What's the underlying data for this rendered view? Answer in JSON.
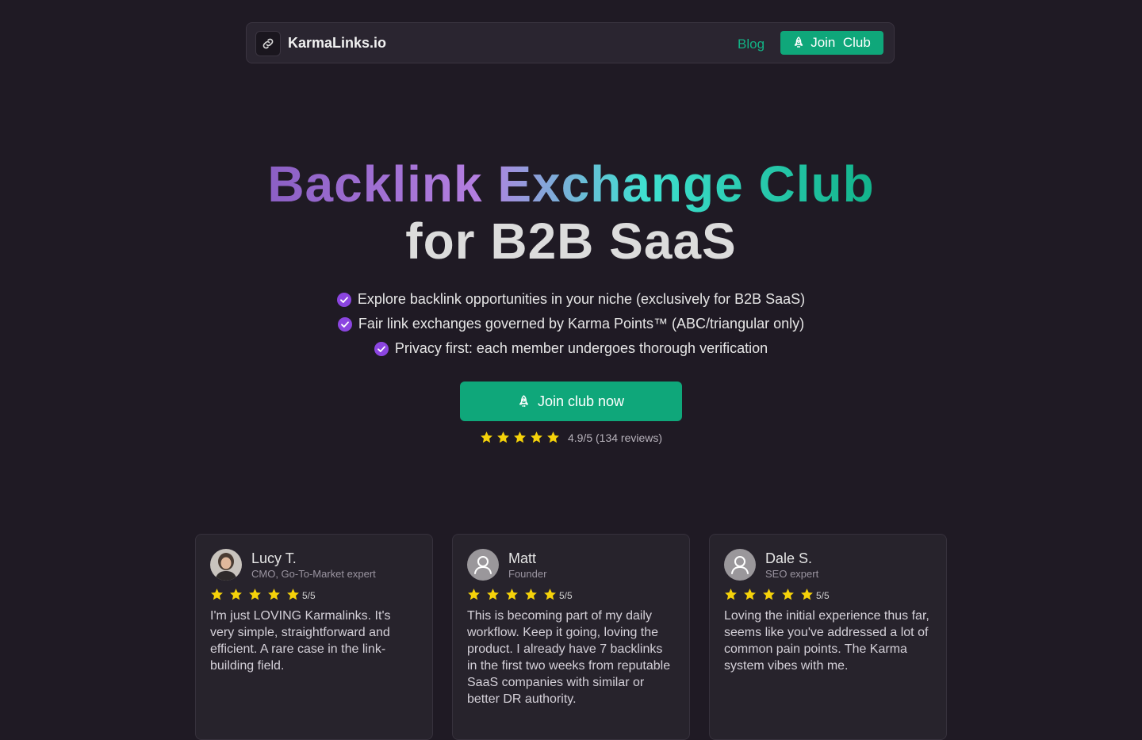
{
  "header": {
    "brand": "KarmaLinks.io",
    "blog_label": "Blog",
    "join_label": "Join  Club",
    "icons": [
      "link-icon",
      "rocket-icon"
    ]
  },
  "hero": {
    "title_line1": "Backlink Exchange Club",
    "title_line2": "for B2B SaaS",
    "features": [
      "Explore backlink opportunities in your niche (exclusively for B2B SaaS)",
      "Fair link exchanges governed by Karma Points™ (ABC/triangular only)",
      "Privacy first: each member undergoes thorough verification"
    ],
    "cta_label": "Join club now",
    "rating_text": "4.9/5 (134 reviews)",
    "rating_stars": 5
  },
  "reviews": [
    {
      "name": "Lucy T.",
      "role": "CMO, Go-To-Market expert",
      "score": "5/5",
      "text": "I'm just LOVING Karmalinks. It's very simple, straightforward and efficient. A rare case in the link-building field."
    },
    {
      "name": "Matt",
      "role": "Founder",
      "score": "5/5",
      "text": "This is becoming part of my daily workflow. Keep it going, loving the product. I already have 7 backlinks in the first two weeks from reputable SaaS companies with similar or better DR authority."
    },
    {
      "name": "Dale S.",
      "role": "SEO expert",
      "score": "5/5",
      "text": "Loving the initial experience thus far, seems like you've addressed a lot of common pain points. The Karma system vibes with me."
    }
  ],
  "colors": {
    "background": "#1f1a24",
    "accent_green": "#0fa77a",
    "check_purple": "#8b45e0",
    "star_yellow": "#f5d20a"
  }
}
